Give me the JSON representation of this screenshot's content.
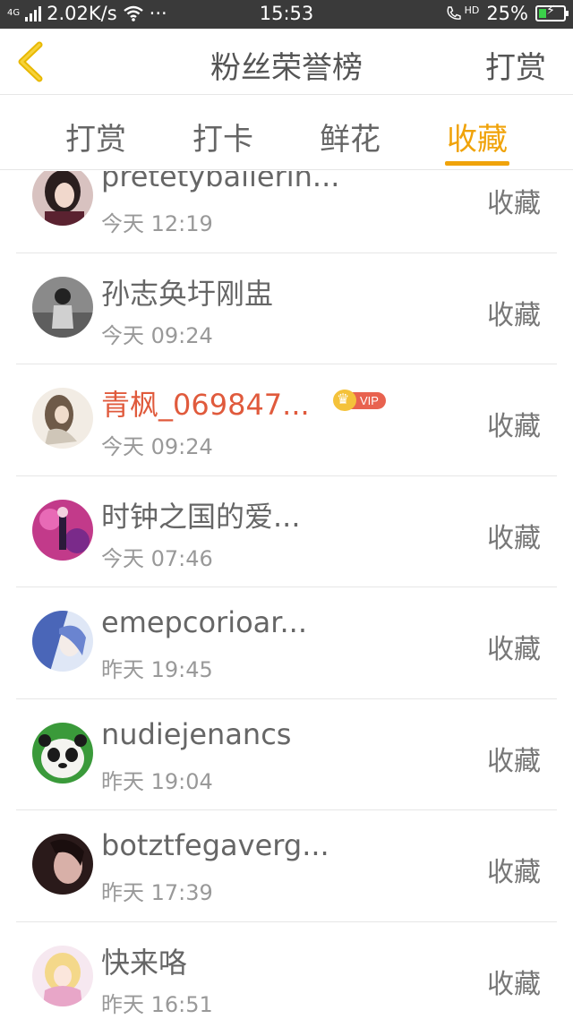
{
  "status_bar": {
    "network": "4G",
    "speed": "2.02K/s",
    "more": "···",
    "time": "15:53",
    "hd": "HD",
    "battery": "25%"
  },
  "header": {
    "title": "粉丝荣誉榜",
    "action": "打赏"
  },
  "tabs": [
    {
      "label": "打赏",
      "active": false
    },
    {
      "label": "打卡",
      "active": false
    },
    {
      "label": "鲜花",
      "active": false
    },
    {
      "label": "收藏",
      "active": true
    }
  ],
  "list": [
    {
      "name": "pretetyballerin...",
      "time": "今天 12:19",
      "action": "收藏",
      "vip": false
    },
    {
      "name": "孙志奂圩刚盅",
      "time": "今天 09:24",
      "action": "收藏",
      "vip": false
    },
    {
      "name": "青枫_069847...",
      "time": "今天 09:24",
      "action": "收藏",
      "vip": true,
      "vip_label": "VIP"
    },
    {
      "name": "时钟之国的爱...",
      "time": "今天 07:46",
      "action": "收藏",
      "vip": false
    },
    {
      "name": "emepcorioar...",
      "time": "昨天 19:45",
      "action": "收藏",
      "vip": false
    },
    {
      "name": "nudiejenancs",
      "time": "昨天 19:04",
      "action": "收藏",
      "vip": false
    },
    {
      "name": "botztfegaverg...",
      "time": "昨天 17:39",
      "action": "收藏",
      "vip": false
    },
    {
      "name": "快来咯",
      "time": "昨天 16:51",
      "action": "收藏",
      "vip": false
    }
  ],
  "colors": {
    "accent": "#f0a30a",
    "vip_name": "#e05a3c",
    "status_bar_bg": "#3a3a3a"
  },
  "icons": {
    "back": "chevron-left-icon",
    "wifi": "wifi-icon",
    "signal": "signal-icon",
    "battery": "battery-charging-icon"
  }
}
